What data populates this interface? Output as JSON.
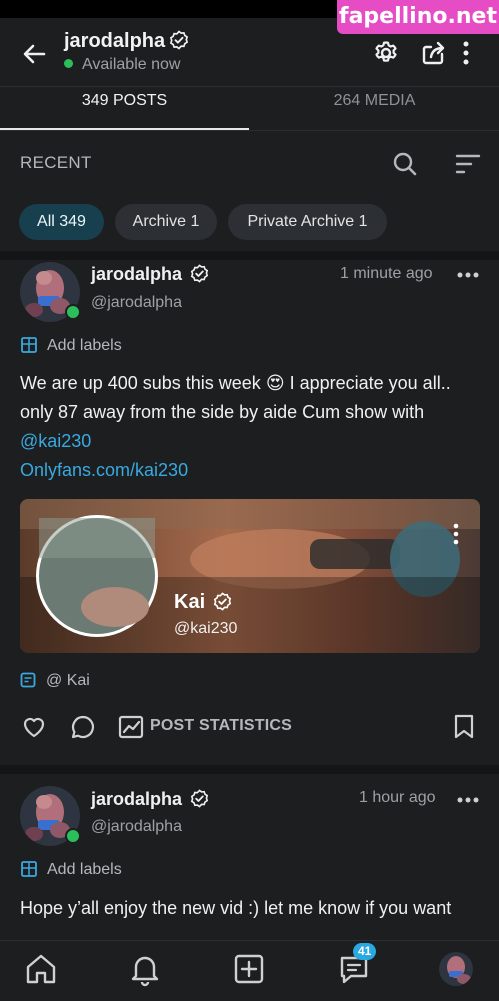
{
  "watermark": "fapellino.net",
  "header": {
    "username": "jarodalpha",
    "status": "Available now"
  },
  "tabs": [
    {
      "label": "349 POSTS",
      "active": true
    },
    {
      "label": "264 MEDIA",
      "active": false
    }
  ],
  "filter": {
    "recent_label": "RECENT",
    "chips": [
      {
        "label": "All 349",
        "active": true
      },
      {
        "label": "Archive 1",
        "active": false
      },
      {
        "label": "Private Archive 1",
        "active": false
      }
    ]
  },
  "posts": [
    {
      "author": "jarodalpha",
      "handle": "@jarodalpha",
      "time": "1 minute ago",
      "add_labels": "Add labels",
      "text_line1": "We are up 400 subs this week",
      "emoji": "😍",
      "text_line1_end": " I appreciate you all..",
      "text_line2": "only 87 away from the side by aide Cum show with",
      "link_mention": "@kai230",
      "link_url": "Onlyfans.com/kai230",
      "card": {
        "name": "Kai",
        "handle": "@kai230"
      },
      "mention_prefix": "@",
      "mention_label": "Kai",
      "stats_label": "POST STATISTICS"
    },
    {
      "author": "jarodalpha",
      "handle": "@jarodalpha",
      "time": "1 hour ago",
      "add_labels": "Add labels",
      "text_line1": "Hope y’all enjoy the new vid :) let me know if you want"
    }
  ],
  "bottom_nav": {
    "items": [
      "home-icon",
      "bell-icon",
      "add-post-icon",
      "messages-icon",
      "profile-avatar"
    ],
    "messages_badge": "41"
  },
  "colors": {
    "background": "#1d1e20",
    "accent": "#39a9e0",
    "online": "#2bbf5b",
    "active_chip": "#173f4d",
    "watermark": "#e64cc4"
  }
}
